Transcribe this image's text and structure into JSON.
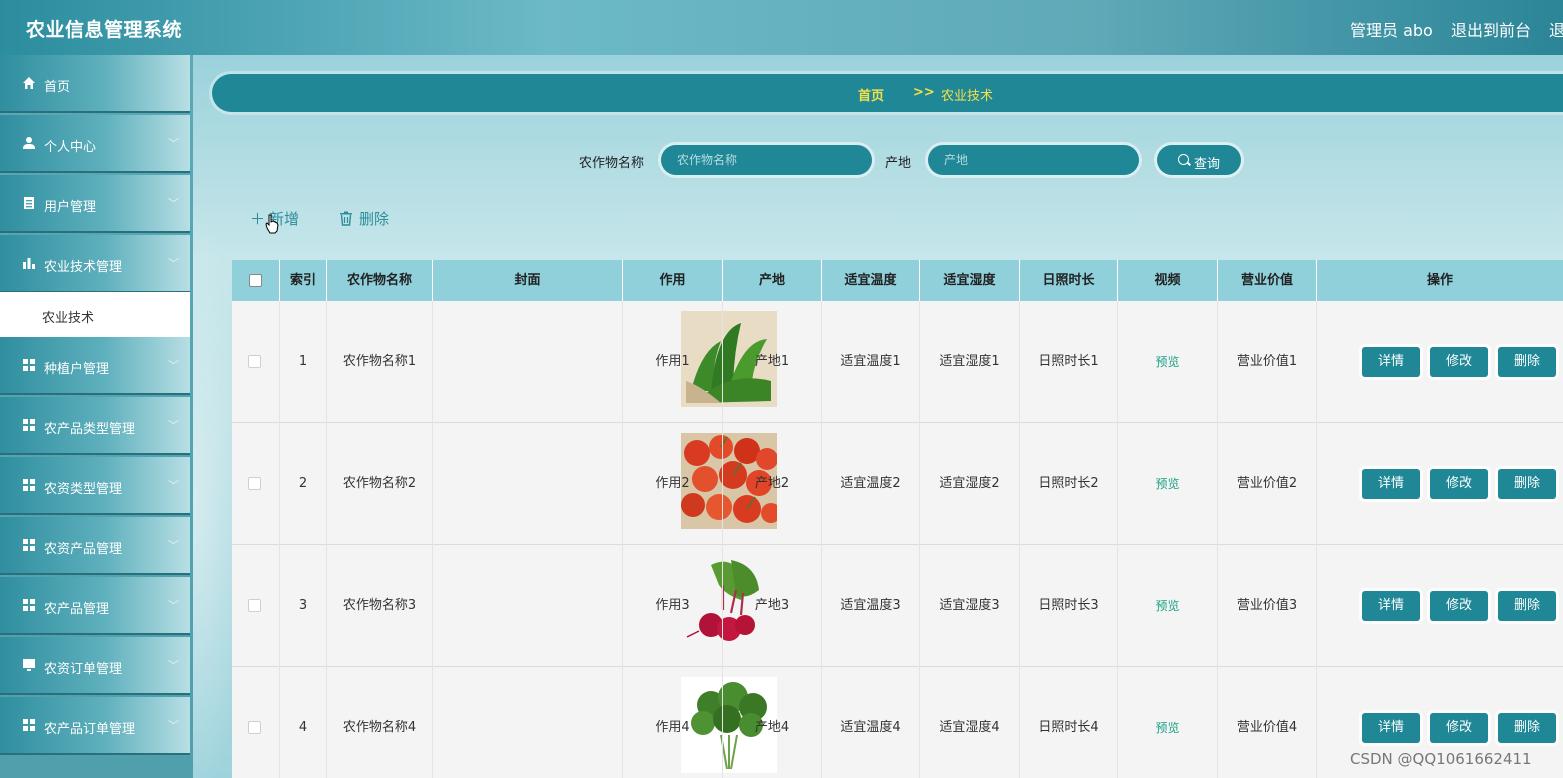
{
  "header": {
    "app_title": "农业信息管理系统",
    "user_label": "管理员 abo",
    "front_link": "退出到前台",
    "logout_link": "退出登录"
  },
  "sidebar": {
    "items": [
      {
        "label": "首页",
        "icon": "home-icon"
      },
      {
        "label": "个人中心",
        "icon": "user-icon"
      },
      {
        "label": "用户管理",
        "icon": "clipboard-icon"
      },
      {
        "label": "农业技术管理",
        "icon": "bar-chart-icon"
      },
      {
        "label": "种植户管理",
        "icon": "grid-icon"
      },
      {
        "label": "农产品类型管理",
        "icon": "grid-icon"
      },
      {
        "label": "农资类型管理",
        "icon": "grid-icon"
      },
      {
        "label": "农资产品管理",
        "icon": "grid-icon"
      },
      {
        "label": "农产品管理",
        "icon": "grid-icon"
      },
      {
        "label": "农资订单管理",
        "icon": "monitor-icon"
      },
      {
        "label": "农产品订单管理",
        "icon": "grid-icon"
      }
    ],
    "active_sub": "农业技术"
  },
  "breadcrumb": {
    "home": "首页",
    "sep": ">>",
    "current": "农业技术"
  },
  "search": {
    "crop_label": "农作物名称",
    "crop_placeholder": "农作物名称",
    "origin_label": "产地",
    "origin_placeholder": "产地",
    "query_label": "查询"
  },
  "toolbar": {
    "add_label": "新增",
    "delete_label": "删除"
  },
  "table": {
    "headers": [
      "索引",
      "农作物名称",
      "封面",
      "作用",
      "产地",
      "适宜温度",
      "适宜湿度",
      "日照时长",
      "视频",
      "营业价值",
      "操作"
    ],
    "rows": [
      {
        "index": "1",
        "name": "农作物名称1",
        "effect": "作用1",
        "origin": "产地1",
        "temp": "适宜温度1",
        "humidity": "适宜湿度1",
        "sunlight": "日照时长1",
        "video": "预览",
        "value": "营业价值1",
        "cover": "leafy-greens"
      },
      {
        "index": "2",
        "name": "农作物名称2",
        "effect": "作用2",
        "origin": "产地2",
        "temp": "适宜温度2",
        "humidity": "适宜湿度2",
        "sunlight": "日照时长2",
        "video": "预览",
        "value": "营业价值2",
        "cover": "cherry-tomatoes"
      },
      {
        "index": "3",
        "name": "农作物名称3",
        "effect": "作用3",
        "origin": "产地3",
        "temp": "适宜温度3",
        "humidity": "适宜湿度3",
        "sunlight": "日照时长3",
        "video": "预览",
        "value": "营业价值3",
        "cover": "radishes"
      },
      {
        "index": "4",
        "name": "农作物名称4",
        "effect": "作用4",
        "origin": "产地4",
        "temp": "适宜温度4",
        "humidity": "适宜湿度4",
        "sunlight": "日照时长4",
        "video": "预览",
        "value": "营业价值4",
        "cover": "cilantro"
      }
    ],
    "actions": {
      "detail": "详情",
      "edit": "修改",
      "delete": "删除"
    }
  },
  "watermark": "CSDN @QQ1061662411",
  "colors": {
    "accent": "#1f8796",
    "breadcrumb_text": "#f5e04a",
    "preview_link": "#1aa185",
    "header_row": "#8fd0db"
  }
}
